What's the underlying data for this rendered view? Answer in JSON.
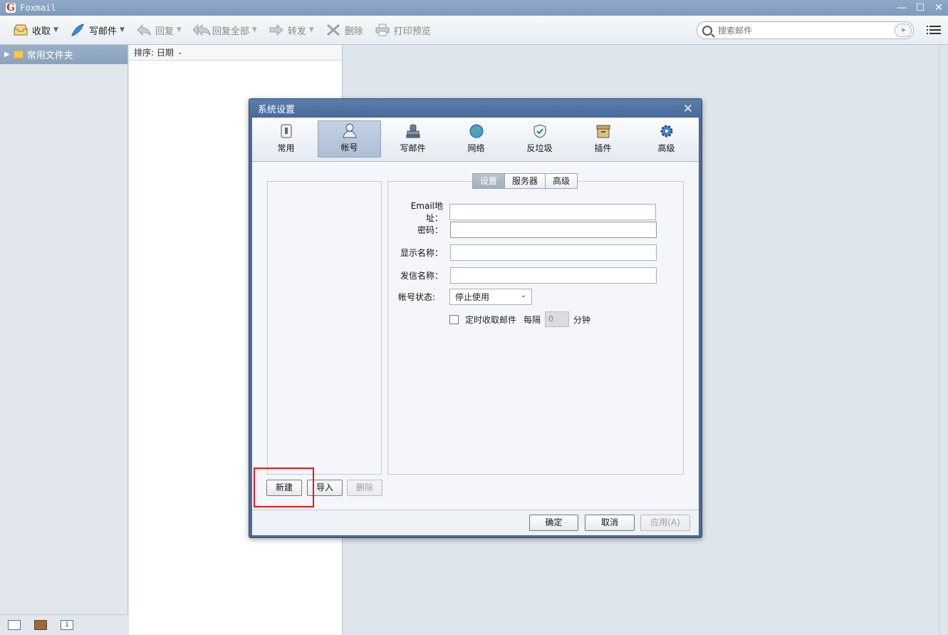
{
  "window": {
    "title": "Foxmail",
    "logo_text": "G",
    "controls": {
      "minimize": "—",
      "maximize": "☐",
      "close": "✕"
    }
  },
  "toolbar": {
    "receive_label": "收取",
    "compose_label": "写邮件",
    "reply_label": "回复",
    "reply_all_label": "回复全部",
    "forward_label": "转发",
    "delete_label": "删除",
    "print_preview_label": "打印预览",
    "search_placeholder": "搜索邮件",
    "search_dropdown": "»"
  },
  "folders": {
    "header_label": "常用文件夹"
  },
  "mail_list": {
    "sort_label": "排序: 日期"
  },
  "bottom_bar": {
    "calendar_day": "1"
  },
  "dialog": {
    "title": "系统设置",
    "close": "✕",
    "categories": [
      {
        "label": "常用",
        "icon": "switch-icon",
        "active": false
      },
      {
        "label": "帐号",
        "icon": "user-icon",
        "active": true
      },
      {
        "label": "写邮件",
        "icon": "stamp-icon",
        "active": false
      },
      {
        "label": "网络",
        "icon": "globe-icon",
        "active": false
      },
      {
        "label": "反垃圾",
        "icon": "shield-icon",
        "active": false
      },
      {
        "label": "插件",
        "icon": "box-icon",
        "active": false
      },
      {
        "label": "高级",
        "icon": "gear-icon",
        "active": false
      }
    ],
    "sub_tabs": [
      "设置",
      "服务器",
      "高级"
    ],
    "form": {
      "email_label": "Email地址：",
      "email_value": "",
      "password_label": "密码：",
      "password_value": "",
      "display_name_label": "显示名称：",
      "display_name_value": "",
      "sender_name_label": "发信名称：",
      "sender_name_value": "",
      "status_label": "帐号状态:",
      "status_value": "停止使用",
      "scheduled_label": "定时收取邮件",
      "scheduled_checked": false,
      "interval_prefix": "每隔",
      "interval_value": "0",
      "interval_unit": "分钟"
    },
    "account_buttons": {
      "new_label": "新建",
      "import_label": "导入",
      "delete_label": "删除"
    },
    "footer_buttons": {
      "ok_label": "确定",
      "cancel_label": "取消",
      "apply_label": "应用(A)"
    }
  },
  "colors": {
    "highlight": "#e8181c",
    "dialog_frame": "#4a6c99",
    "title_bar": "#8fa9c8"
  }
}
